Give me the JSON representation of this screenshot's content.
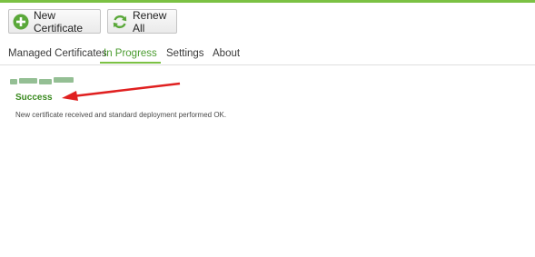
{
  "toolbar": {
    "new_certificate_label": "New Certificate",
    "renew_all_label": "Renew All"
  },
  "tabs": [
    {
      "label": "Managed Certificates",
      "active": false
    },
    {
      "label": "In Progress",
      "active": true
    },
    {
      "label": "Settings",
      "active": false
    },
    {
      "label": "About",
      "active": false
    }
  ],
  "progress": {
    "status": "Success",
    "message": "New certificate received and standard deployment performed OK."
  },
  "icons": {
    "new_certificate": "plus-circle-icon",
    "renew_all": "refresh-icon"
  },
  "colors": {
    "accent": "#7bc143",
    "success": "#3a8a1f",
    "annotation_arrow": "#e02020"
  }
}
